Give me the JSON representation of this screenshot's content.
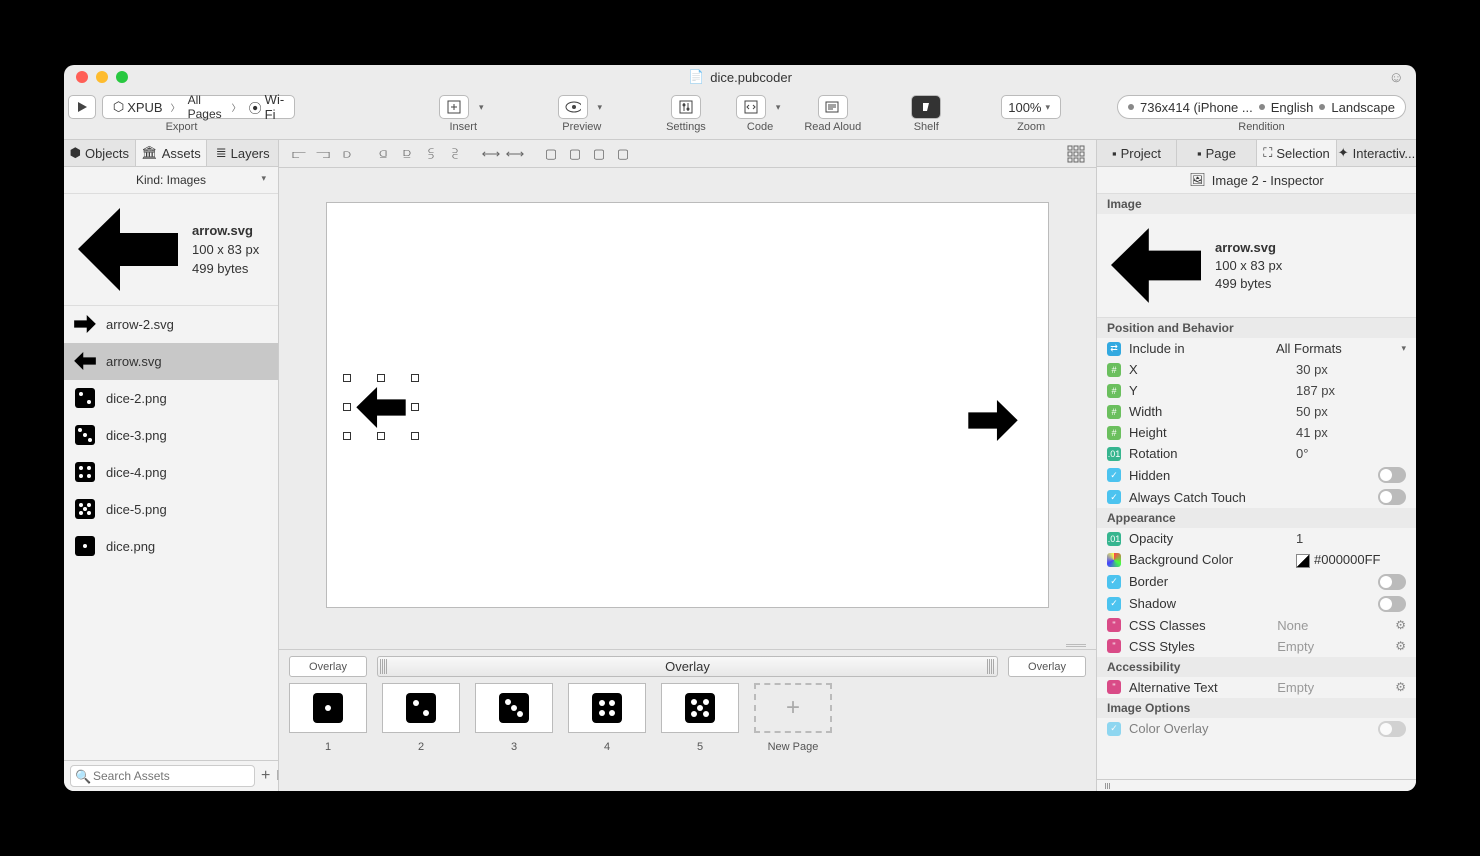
{
  "title": "dice.pubcoder",
  "toolbar": {
    "export_label": "Export",
    "insert_label": "Insert",
    "preview_label": "Preview",
    "settings_label": "Settings",
    "code_label": "Code",
    "read_aloud_label": "Read Aloud",
    "shelf_label": "Shelf",
    "zoom_label": "Zoom",
    "zoom_value": "100%",
    "rendition_label": "Rendition",
    "rendition_size": "736x414 (iPhone ...",
    "rendition_lang": "English",
    "rendition_orient": "Landscape",
    "crumb1": "XPUB",
    "crumb2": "All Pages",
    "crumb3": "Wi-Fi"
  },
  "left_tabs": {
    "objects": "Objects",
    "assets": "Assets",
    "layers": "Layers"
  },
  "kind_label": "Kind: Images",
  "asset_preview": {
    "filename": "arrow.svg",
    "dims": "100 x 83 px",
    "size": "499 bytes"
  },
  "assets": [
    {
      "name": "arrow-2.svg",
      "icon": "arrow-right"
    },
    {
      "name": "arrow.svg",
      "icon": "arrow-left",
      "selected": true
    },
    {
      "name": "dice-2.png",
      "icon": "dice2"
    },
    {
      "name": "dice-3.png",
      "icon": "dice3"
    },
    {
      "name": "dice-4.png",
      "icon": "dice4"
    },
    {
      "name": "dice-5.png",
      "icon": "dice5"
    },
    {
      "name": "dice.png",
      "icon": "dice1"
    }
  ],
  "search_placeholder": "Search Assets",
  "overlay_label": "Overlay",
  "pages": [
    "1",
    "2",
    "3",
    "4",
    "5"
  ],
  "new_page_label": "New Page",
  "right_tabs": {
    "project": "Project",
    "page": "Page",
    "selection": "Selection",
    "interactivity": "Interactiv..."
  },
  "inspector_title": "Image 2 - Inspector",
  "inspector_image_section": "Image",
  "inspector_preview": {
    "filename": "arrow.svg",
    "dims": "100 x 83 px",
    "size": "499 bytes"
  },
  "sections": {
    "posbeh": "Position and Behavior",
    "appearance": "Appearance",
    "accessibility": "Accessibility",
    "imgopts": "Image Options"
  },
  "props": {
    "include_in": {
      "label": "Include in",
      "value": "All Formats"
    },
    "x": {
      "label": "X",
      "value": "30 px"
    },
    "y": {
      "label": "Y",
      "value": "187 px"
    },
    "width": {
      "label": "Width",
      "value": "50 px"
    },
    "height": {
      "label": "Height",
      "value": "41 px"
    },
    "rotation": {
      "label": "Rotation",
      "value": "0°"
    },
    "hidden": {
      "label": "Hidden"
    },
    "catch_touch": {
      "label": "Always Catch Touch"
    },
    "opacity": {
      "label": "Opacity",
      "value": "1"
    },
    "bgcolor": {
      "label": "Background Color",
      "value": "#000000FF"
    },
    "border": {
      "label": "Border"
    },
    "shadow": {
      "label": "Shadow"
    },
    "css_classes": {
      "label": "CSS Classes",
      "value": "None"
    },
    "css_styles": {
      "label": "CSS Styles",
      "value": "Empty"
    },
    "alt_text": {
      "label": "Alternative Text",
      "value": "Empty"
    },
    "color_overlay": {
      "label": "Color Overlay"
    }
  }
}
